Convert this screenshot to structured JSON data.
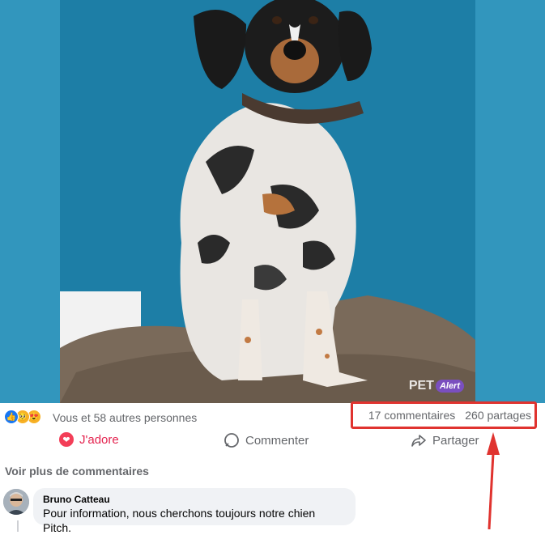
{
  "post": {
    "photo": {
      "subject": "dog-photo",
      "watermark_pet": "PET",
      "watermark_alert": "Alert"
    },
    "reactions": {
      "text": "Vous et 58 autres personnes",
      "icons": [
        "like-icon",
        "care-icon",
        "love-face-icon"
      ]
    },
    "stats": {
      "comments": "17 commentaires",
      "shares": "260 partages"
    },
    "actions": {
      "love_label": "J'adore",
      "comment_label": "Commenter",
      "share_label": "Partager"
    },
    "more_comments_label": "Voir plus de commentaires",
    "comments": [
      {
        "author": "Bruno Catteau",
        "text": "Pour information, nous cherchons toujours notre chien Pitch."
      }
    ]
  },
  "colors": {
    "highlight": "#e0332f",
    "love": "#e4234f",
    "like": "#1877f2",
    "secondary_text": "#65676b",
    "photo_bg": "#1f7fa5"
  }
}
